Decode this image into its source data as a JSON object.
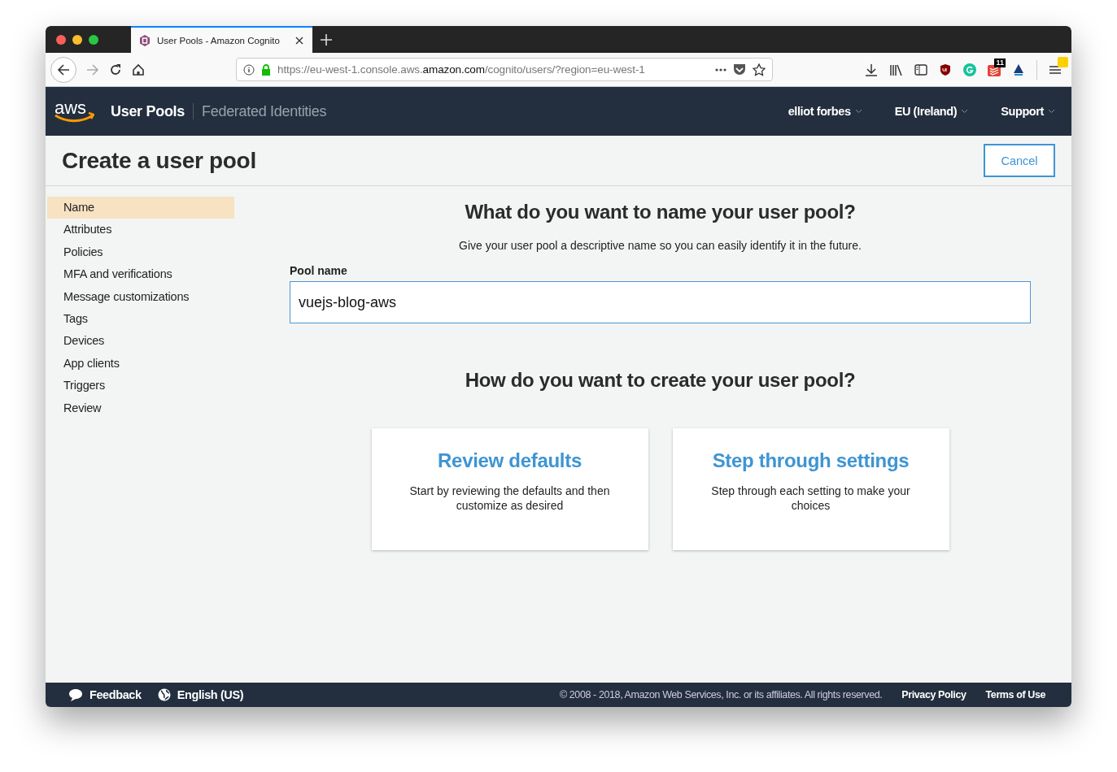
{
  "browser": {
    "tab_title": "User Pools - Amazon Cognito",
    "url": {
      "prefix": "https://eu-west-1.console.aws.",
      "domain": "amazon.com",
      "suffix": "/cognito/users/?region=eu-west-1"
    },
    "extension_badge": "11"
  },
  "header": {
    "logo_text": "aws",
    "nav": [
      {
        "label": "User Pools",
        "selected": true
      },
      {
        "label": "Federated Identities",
        "selected": false
      }
    ],
    "menus": [
      "elliot forbes",
      "EU (Ireland)",
      "Support"
    ]
  },
  "title": "Create a user pool",
  "cancel": "Cancel",
  "sidebar": [
    {
      "label": "Name",
      "selected": true
    },
    {
      "label": "Attributes",
      "selected": false
    },
    {
      "label": "Policies",
      "selected": false
    },
    {
      "label": "MFA and verifications",
      "selected": false
    },
    {
      "label": "Message customizations",
      "selected": false
    },
    {
      "label": "Tags",
      "selected": false
    },
    {
      "label": "Devices",
      "selected": false
    },
    {
      "label": "App clients",
      "selected": false
    },
    {
      "label": "Triggers",
      "selected": false
    },
    {
      "label": "Review",
      "selected": false
    }
  ],
  "name_section": {
    "heading": "What do you want to name your user pool?",
    "description": "Give your user pool a descriptive name so you can easily identify it in the future.",
    "field_label": "Pool name",
    "value": "vuejs-blog-aws"
  },
  "create_section": {
    "heading": "How do you want to create your user pool?",
    "options": [
      {
        "title": "Review defaults",
        "description": "Start by reviewing the defaults and then customize as desired"
      },
      {
        "title": "Step through settings",
        "description": "Step through each setting to make your choices"
      }
    ]
  },
  "footer": {
    "feedback": "Feedback",
    "language": "English (US)",
    "copyright": "© 2008 - 2018, Amazon Web Services, Inc. or its affiliates. All rights reserved.",
    "links": [
      "Privacy Policy",
      "Terms of Use"
    ]
  }
}
